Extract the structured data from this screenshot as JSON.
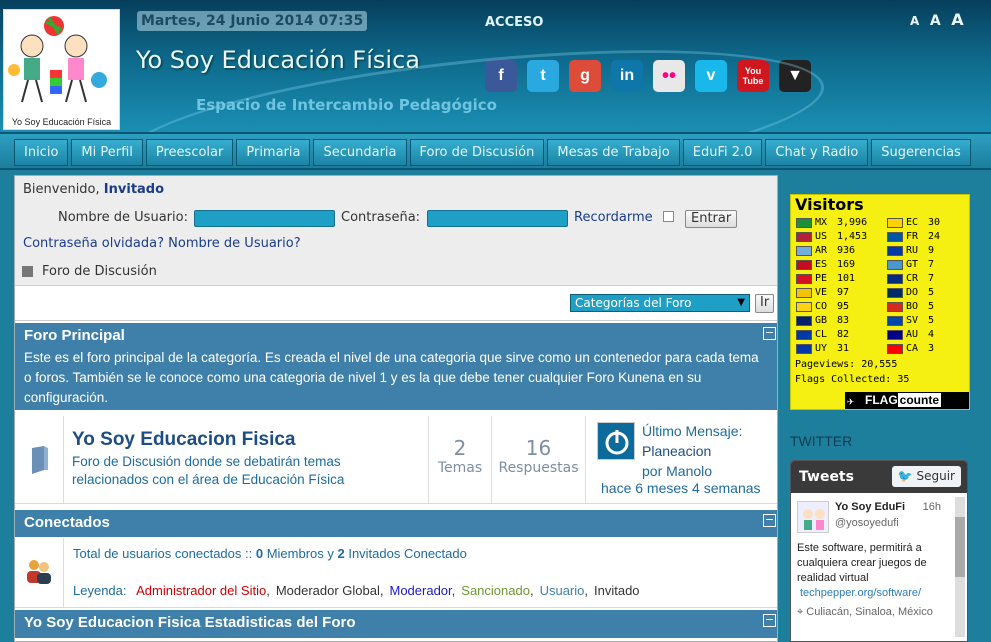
{
  "header": {
    "date": "Martes, 24 Junio 2014 07:35",
    "acceso": "ACCESO",
    "logo_text": "Yo Soy Educación Física",
    "site_title": "Yo Soy Educación Física",
    "subtitle": "Espacio de Intercambio Pedagógico",
    "font_sizer": [
      "A",
      "A",
      "A"
    ],
    "social": [
      {
        "icon": "facebook-icon",
        "glyph": "f",
        "color": "#3b5998"
      },
      {
        "icon": "twitter-icon",
        "glyph": "t",
        "color": "#2aa9e0"
      },
      {
        "icon": "google-icon",
        "glyph": "g",
        "color": "#dd4b39"
      },
      {
        "icon": "linkedin-icon",
        "glyph": "in",
        "color": "#0e76a8"
      },
      {
        "icon": "flickr-icon",
        "glyph": "••",
        "color": "#e8e8e8"
      },
      {
        "icon": "vimeo-icon",
        "glyph": "v",
        "color": "#1ab7ea"
      },
      {
        "icon": "youtube-icon",
        "glyph": "You Tube",
        "color": "#cc181e"
      },
      {
        "icon": "dropdown-icon",
        "glyph": "▼",
        "color": "#222222"
      }
    ]
  },
  "nav": [
    "Inicio",
    "Mi Perfil",
    "Preescolar",
    "Primaria",
    "Secundaria",
    "Foro de Discusión",
    "Mesas de Trabajo",
    "EduFi 2.0",
    "Chat y Radio",
    "Sugerencias"
  ],
  "login": {
    "welcome": "Bienvenido,",
    "guest": "Invitado",
    "username_label": "Nombre de Usuario:",
    "password_label": "Contraseña:",
    "remember_label": "Recordarme",
    "submit": "Entrar",
    "forgot_password": "Contraseña olvidada?",
    "forgot_username": "Nombre de Usuario?",
    "forum_crumb": "Foro de Discusión"
  },
  "categories": {
    "selected": "Categorías del Foro",
    "go": "Ir"
  },
  "forum_principal": {
    "title": "Foro Principal",
    "description": "Este es el foro principal de la categoría. Es creada el nivel de una categoria que sirve como un contenedor para cada tema o foros. También se le conoce como una categoria de nivel 1 y es la que debe tener cualquier Foro Kunena en su configuración.",
    "forum": {
      "name": "Yo Soy Educacion Fisica",
      "description": "Foro de Discusión donde se debatirán temas relacionados con el área de Educación Física",
      "topics": "2",
      "topics_label": "Temas",
      "replies": "16",
      "replies_label": "Respuestas",
      "last_label": "Último Mensaje:",
      "last_title": "Planeacion",
      "last_by": "por Manolo",
      "last_time": "hace 6 meses 4 semanas"
    }
  },
  "connected": {
    "title": "Conectados",
    "total_prefix": "Total de usuarios conectados :: ",
    "members": "0",
    "members_label": " Miembros y ",
    "guests": "2",
    "guests_label": " Invitados Conectado",
    "legend_label": "Leyenda:",
    "legend": [
      {
        "label": "Administrador del Sitio",
        "color": "#cc0000"
      },
      {
        "label": "Moderador Global",
        "color": "#333333"
      },
      {
        "label": "Moderador",
        "color": "#1a1ac8"
      },
      {
        "label": "Sancionado",
        "color": "#6e9a33"
      },
      {
        "label": "Usuario",
        "color": "#3f80ab"
      },
      {
        "label": "Invitado",
        "color": "#333333"
      }
    ]
  },
  "stats": {
    "title": "Yo Soy Educacion Fisica Estadisticas del Foro"
  },
  "visitors": {
    "title": "Visitors",
    "left": [
      {
        "code": "MX",
        "count": "3,996",
        "flag": "#1b8f3a"
      },
      {
        "code": "US",
        "count": "1,453",
        "flag": "#b22234"
      },
      {
        "code": "AR",
        "count": "936",
        "flag": "#74acdf"
      },
      {
        "code": "ES",
        "count": "169",
        "flag": "#c60b1e"
      },
      {
        "code": "PE",
        "count": "101",
        "flag": "#d91023"
      },
      {
        "code": "VE",
        "count": "97",
        "flag": "#f4c300"
      },
      {
        "code": "CO",
        "count": "95",
        "flag": "#fcd116"
      },
      {
        "code": "GB",
        "count": "83",
        "flag": "#012169"
      },
      {
        "code": "CL",
        "count": "82",
        "flag": "#0039a6"
      },
      {
        "code": "UY",
        "count": "31",
        "flag": "#0038a8"
      }
    ],
    "right": [
      {
        "code": "EC",
        "count": "30",
        "flag": "#ffd100"
      },
      {
        "code": "FR",
        "count": "24",
        "flag": "#0055a4"
      },
      {
        "code": "RU",
        "count": "9",
        "flag": "#0039a6"
      },
      {
        "code": "GT",
        "count": "7",
        "flag": "#4997d0"
      },
      {
        "code": "CR",
        "count": "7",
        "flag": "#002b7f"
      },
      {
        "code": "DO",
        "count": "5",
        "flag": "#002d62"
      },
      {
        "code": "BO",
        "count": "5",
        "flag": "#d52b1e"
      },
      {
        "code": "SV",
        "count": "5",
        "flag": "#0047ab"
      },
      {
        "code": "AU",
        "count": "4",
        "flag": "#00008b"
      },
      {
        "code": "CA",
        "count": "3",
        "flag": "#ff0000"
      }
    ],
    "pageviews": "Pageviews: 20,555",
    "flags_collected": "Flags Collected: 35",
    "brand": "FLAG",
    "brand2": "counte"
  },
  "twitter": {
    "label": "TWITTER",
    "header": "Tweets",
    "follow": "Seguir",
    "author": "Yo Soy EduFi",
    "handle": "@yosoyedufi",
    "time": "16h",
    "text": "Este software, permitirá a cualquiera crear juegos de realidad virtual",
    "link": "techpepper.org/software/",
    "location": "Culiacán, Sinaloa, México"
  }
}
